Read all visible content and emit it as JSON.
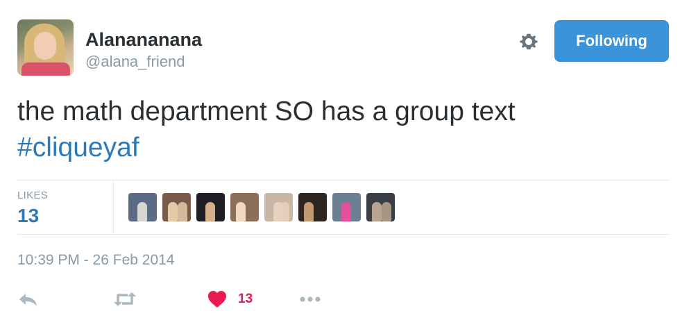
{
  "user": {
    "name": "Alanananana",
    "handle": "@alana_friend"
  },
  "follow_button": {
    "label": "Following"
  },
  "tweet": {
    "text": "the math department SO has a group text",
    "hashtag": "#cliqueyaf"
  },
  "stats": {
    "likes_label": "LIKES",
    "likes_count": "13"
  },
  "likers": [
    {
      "name": "liker-1",
      "bg": "#5b6b85",
      "fg": "#d8d6d0"
    },
    {
      "name": "liker-2",
      "bg": "#7a5a4a",
      "fg": "#e6c9a8"
    },
    {
      "name": "liker-3",
      "bg": "#1e1e24",
      "fg": "#d6b08a"
    },
    {
      "name": "liker-4",
      "bg": "#8c6f5a",
      "fg": "#f0d9c2"
    },
    {
      "name": "liker-5",
      "bg": "#c8b6a6",
      "fg": "#e9d2bd"
    },
    {
      "name": "liker-6",
      "bg": "#2e2620",
      "fg": "#c29a72"
    },
    {
      "name": "liker-7",
      "bg": "#6d7f95",
      "fg": "#e5509a"
    },
    {
      "name": "liker-8",
      "bg": "#3a3f47",
      "fg": "#b9a58e"
    }
  ],
  "timestamp": "10:39 PM - 26 Feb 2014",
  "actions": {
    "reply_icon": "reply-icon",
    "retweet_icon": "retweet-icon",
    "like_icon": "heart-icon",
    "like_count": "13",
    "more_icon": "more-icon"
  },
  "colors": {
    "accent": "#3b94d9",
    "link": "#2b7bb9",
    "like": "#e81c4f",
    "muted": "#8899a6"
  }
}
